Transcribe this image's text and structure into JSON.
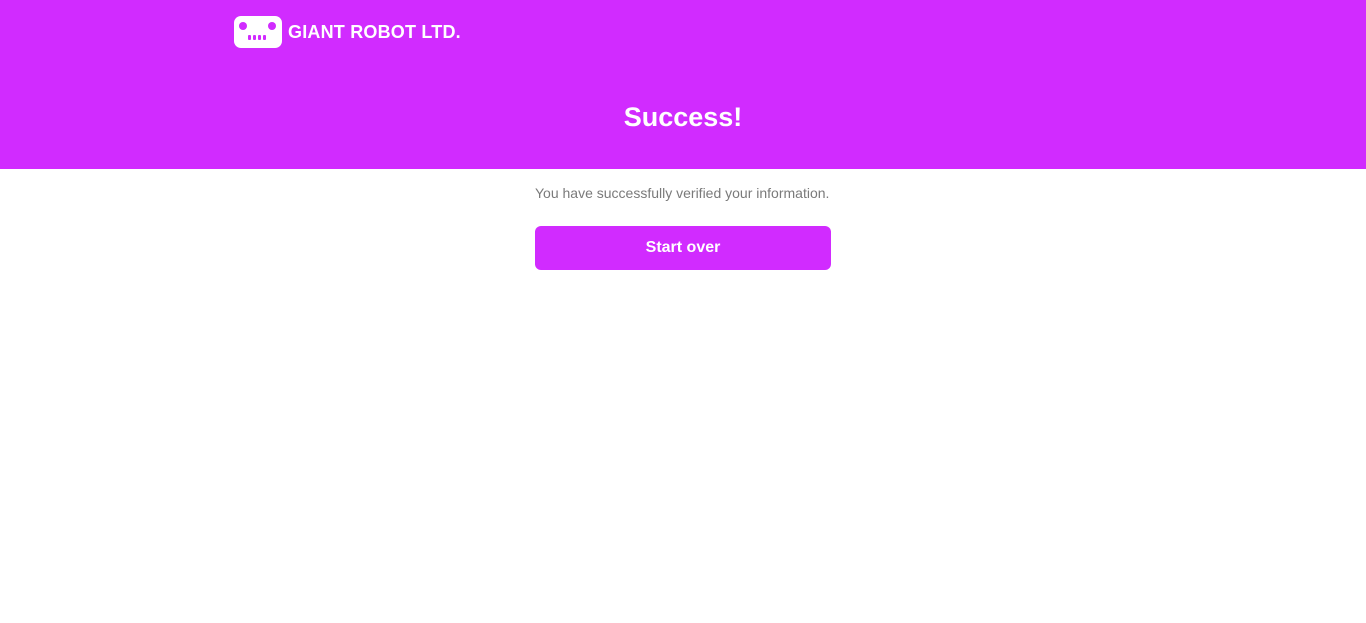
{
  "brand": {
    "name": "GIANT ROBOT LTD.",
    "logo_icon": "robot-face-icon"
  },
  "main": {
    "title": "Success!",
    "message": "You have successfully verified your information.",
    "start_over_label": "Start over"
  },
  "colors": {
    "accent": "#d12bff",
    "background": "#ffffff",
    "muted_text": "#7a7a7a"
  }
}
